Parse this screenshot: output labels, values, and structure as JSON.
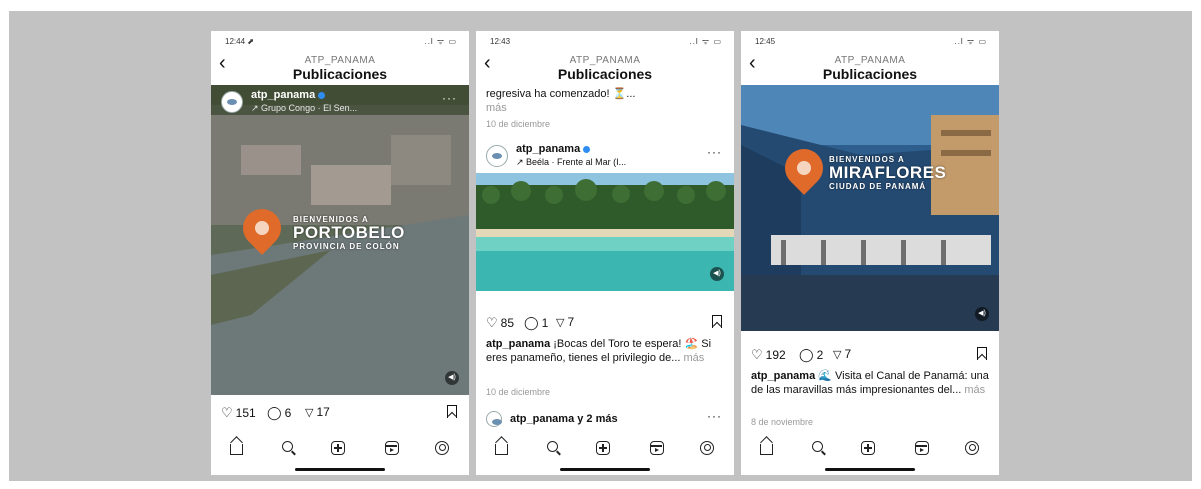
{
  "header": {
    "back_icon": "chevron-left-icon",
    "account": "ATP_PANAMA",
    "title": "Publicaciones"
  },
  "phones": [
    {
      "time": "12:44 ⬈",
      "post": {
        "username": "atp_panama",
        "location": "↗ Grupo Congo · El Sen...",
        "media": {
          "kicker": "BIENVENIDOS A",
          "headline": "PORTOBELO",
          "subline": "PROVINCIA DE COLÓN"
        },
        "likes": "151",
        "comments": "6",
        "shares": "17"
      }
    },
    {
      "time": "12:43",
      "prev_caption": "regresiva ha comenzado! ⏳...",
      "prev_more": "más",
      "prev_date": "10 de diciembre",
      "post": {
        "username": "atp_panama",
        "location": "↗ Beéla · Frente al Mar (I...",
        "likes": "85",
        "comments": "1",
        "shares": "7",
        "caption_user": "atp_panama",
        "caption_text": "¡Bocas del Toro te espera! 🏖️ Si eres panameño, tienes el privilegio de...",
        "caption_more": "más",
        "date": "10 de diciembre"
      },
      "next_post_user": "atp_panama y 2 más"
    },
    {
      "time": "12:45",
      "post": {
        "media": {
          "kicker": "BIENVENIDOS A",
          "headline": "MIRAFLORES",
          "subline": "CIUDAD DE PANAMÁ"
        },
        "likes": "192",
        "comments": "2",
        "shares": "7",
        "caption_user": "atp_panama",
        "caption_text": "🌊 Visita el Canal de Panamá: una de las maravillas más impresionantes del...",
        "caption_more": "más",
        "date": "8 de noviembre"
      }
    }
  ],
  "status_icons": "..l ᯤ ▭",
  "nav": [
    "home-icon",
    "search-icon",
    "add-icon",
    "reels-icon",
    "profile-icon"
  ],
  "colors": {
    "background": "#c2c2c2",
    "pin": "#e06a2a",
    "verified": "#2f8cf0"
  }
}
